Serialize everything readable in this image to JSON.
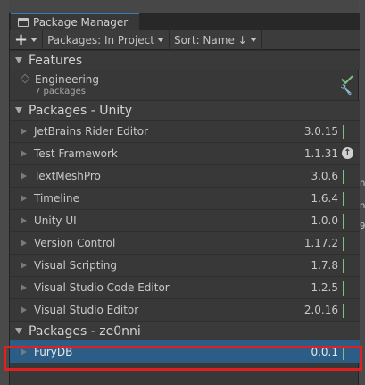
{
  "window": {
    "tab_title": "Package Manager"
  },
  "toolbar": {
    "add_label": "+",
    "packages_filter": "Packages: In Project",
    "sort_label": "Sort: Name ↓"
  },
  "sections": {
    "features": {
      "label": "Features"
    },
    "unity": {
      "label": "Packages - Unity"
    },
    "user": {
      "label": "Packages - ze0nni"
    }
  },
  "feature_item": {
    "title": "Engineering",
    "subtitle": "7 packages"
  },
  "unity_packages": [
    {
      "name": "JetBrains Rider Editor",
      "version": "3.0.15",
      "status": "check"
    },
    {
      "name": "Test Framework",
      "version": "1.1.31",
      "status": "update"
    },
    {
      "name": "TextMeshPro",
      "version": "3.0.6",
      "status": "check"
    },
    {
      "name": "Timeline",
      "version": "1.6.4",
      "status": "check"
    },
    {
      "name": "Unity UI",
      "version": "1.0.0",
      "status": "check"
    },
    {
      "name": "Version Control",
      "version": "1.17.2",
      "status": "check"
    },
    {
      "name": "Visual Scripting",
      "version": "1.7.8",
      "status": "check"
    },
    {
      "name": "Visual Studio Code Editor",
      "version": "1.2.5",
      "status": "check"
    },
    {
      "name": "Visual Studio Editor",
      "version": "2.0.16",
      "status": "check"
    }
  ],
  "user_packages": [
    {
      "name": "FuryDB",
      "version": "0.0.1",
      "status": "check"
    }
  ],
  "icons": {
    "update": "↑"
  },
  "colors": {
    "selection": "#2c5d87",
    "check": "#7cc184",
    "highlight_border": "#e02020",
    "tab_accent": "#3a79bb"
  }
}
